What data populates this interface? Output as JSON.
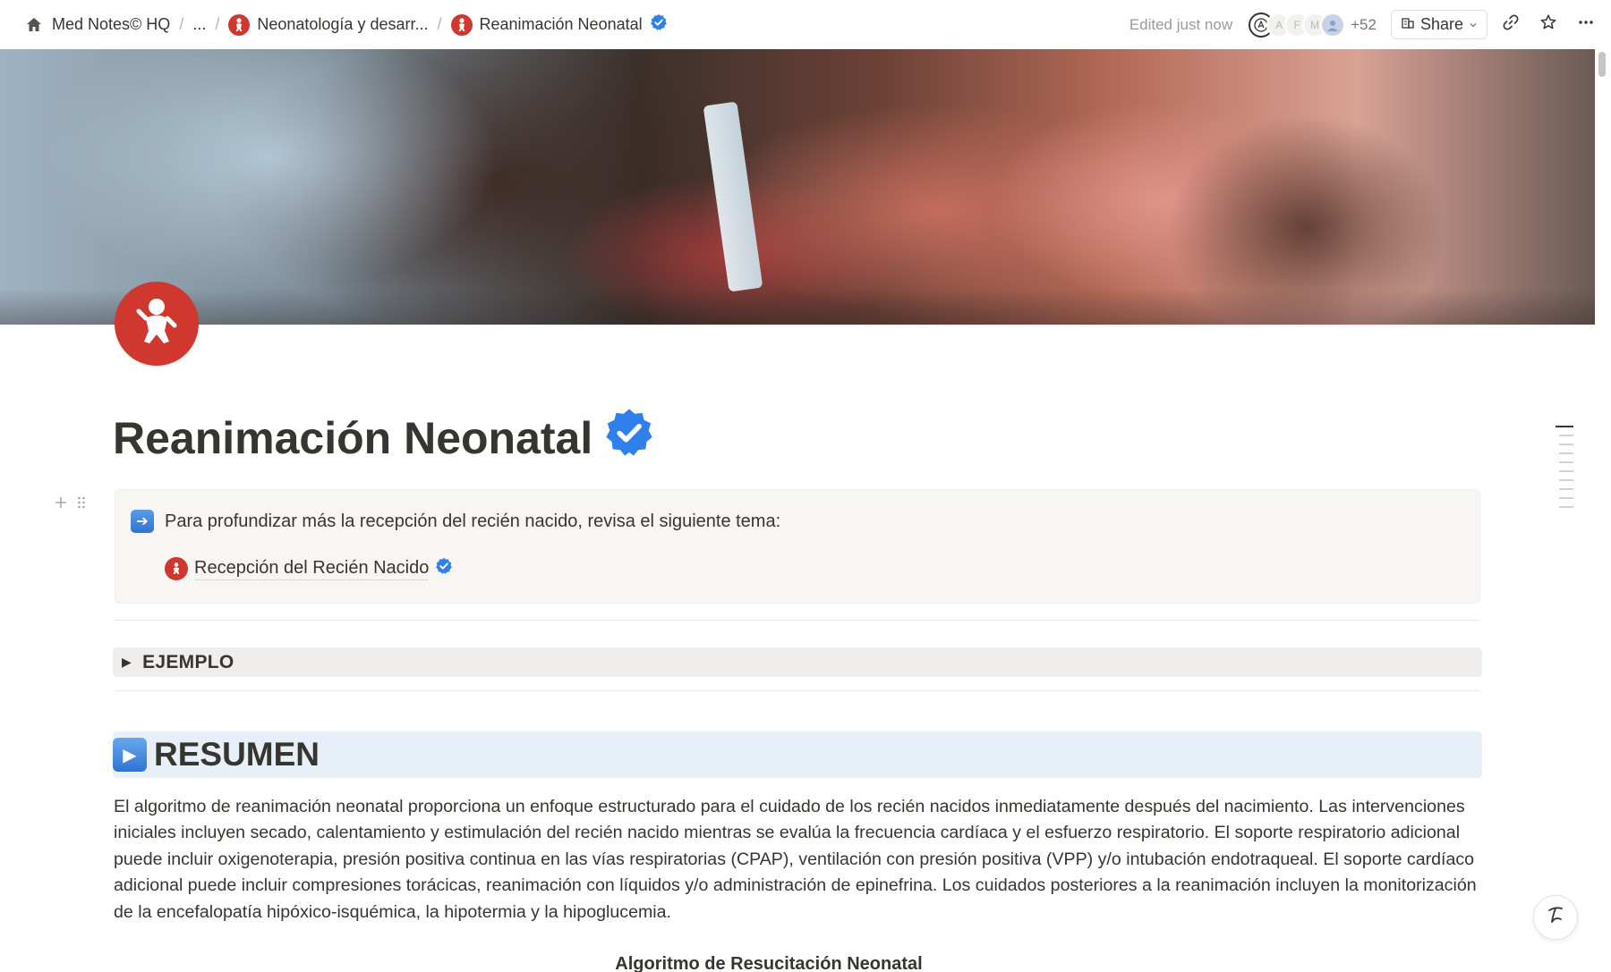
{
  "breadcrumb": {
    "items": [
      {
        "label": "Med Notes© HQ",
        "icon": "home-icon"
      },
      {
        "label": "..."
      },
      {
        "label": "Neonatología y desarr...",
        "icon": "baby-red-icon"
      },
      {
        "label": "Reanimación Neonatal",
        "icon": "baby-red-icon",
        "verified": true
      }
    ]
  },
  "topbar": {
    "edited": "Edited just now",
    "avatars": [
      "A",
      "F",
      "M"
    ],
    "more_count": "+52",
    "share_label": "Share"
  },
  "page": {
    "title": "Reanimación Neonatal",
    "icon": "baby-red-icon",
    "accent": "#d0372f",
    "verified_color": "#2f80ed"
  },
  "callout": {
    "text": "Para profundizar más la recepción del recién nacido, revisa el siguiente tema:",
    "link_label": "Recepción del Recién Nacido"
  },
  "toggle": {
    "label": "EJEMPLO"
  },
  "resumen": {
    "heading": "RESUMEN",
    "paragraph": "El algoritmo de reanimación neonatal proporciona un enfoque estructurado para el cuidado de los recién nacidos inmediatamente después del nacimiento. Las intervenciones iniciales incluyen secado, calentamiento y estimulación del recién nacido mientras se evalúa la frecuencia cardíaca y el esfuerzo respiratorio. El soporte respiratorio adicional puede incluir oxigenoterapia, presión positiva continua en las vías respiratorias (CPAP), ventilación con presión positiva (VPP) y/o intubación endotraqueal. El soporte cardíaco adicional puede incluir compresiones torácicas, reanimación con líquidos y/o administración de epinefrina. Los cuidados posteriores a la reanimación incluyen la monitorización de la encefalopatía hipóxico-isquémica, la hipotermia y la hipoglucemia.",
    "subheading": "Algoritmo de Resucitación Neonatal"
  }
}
